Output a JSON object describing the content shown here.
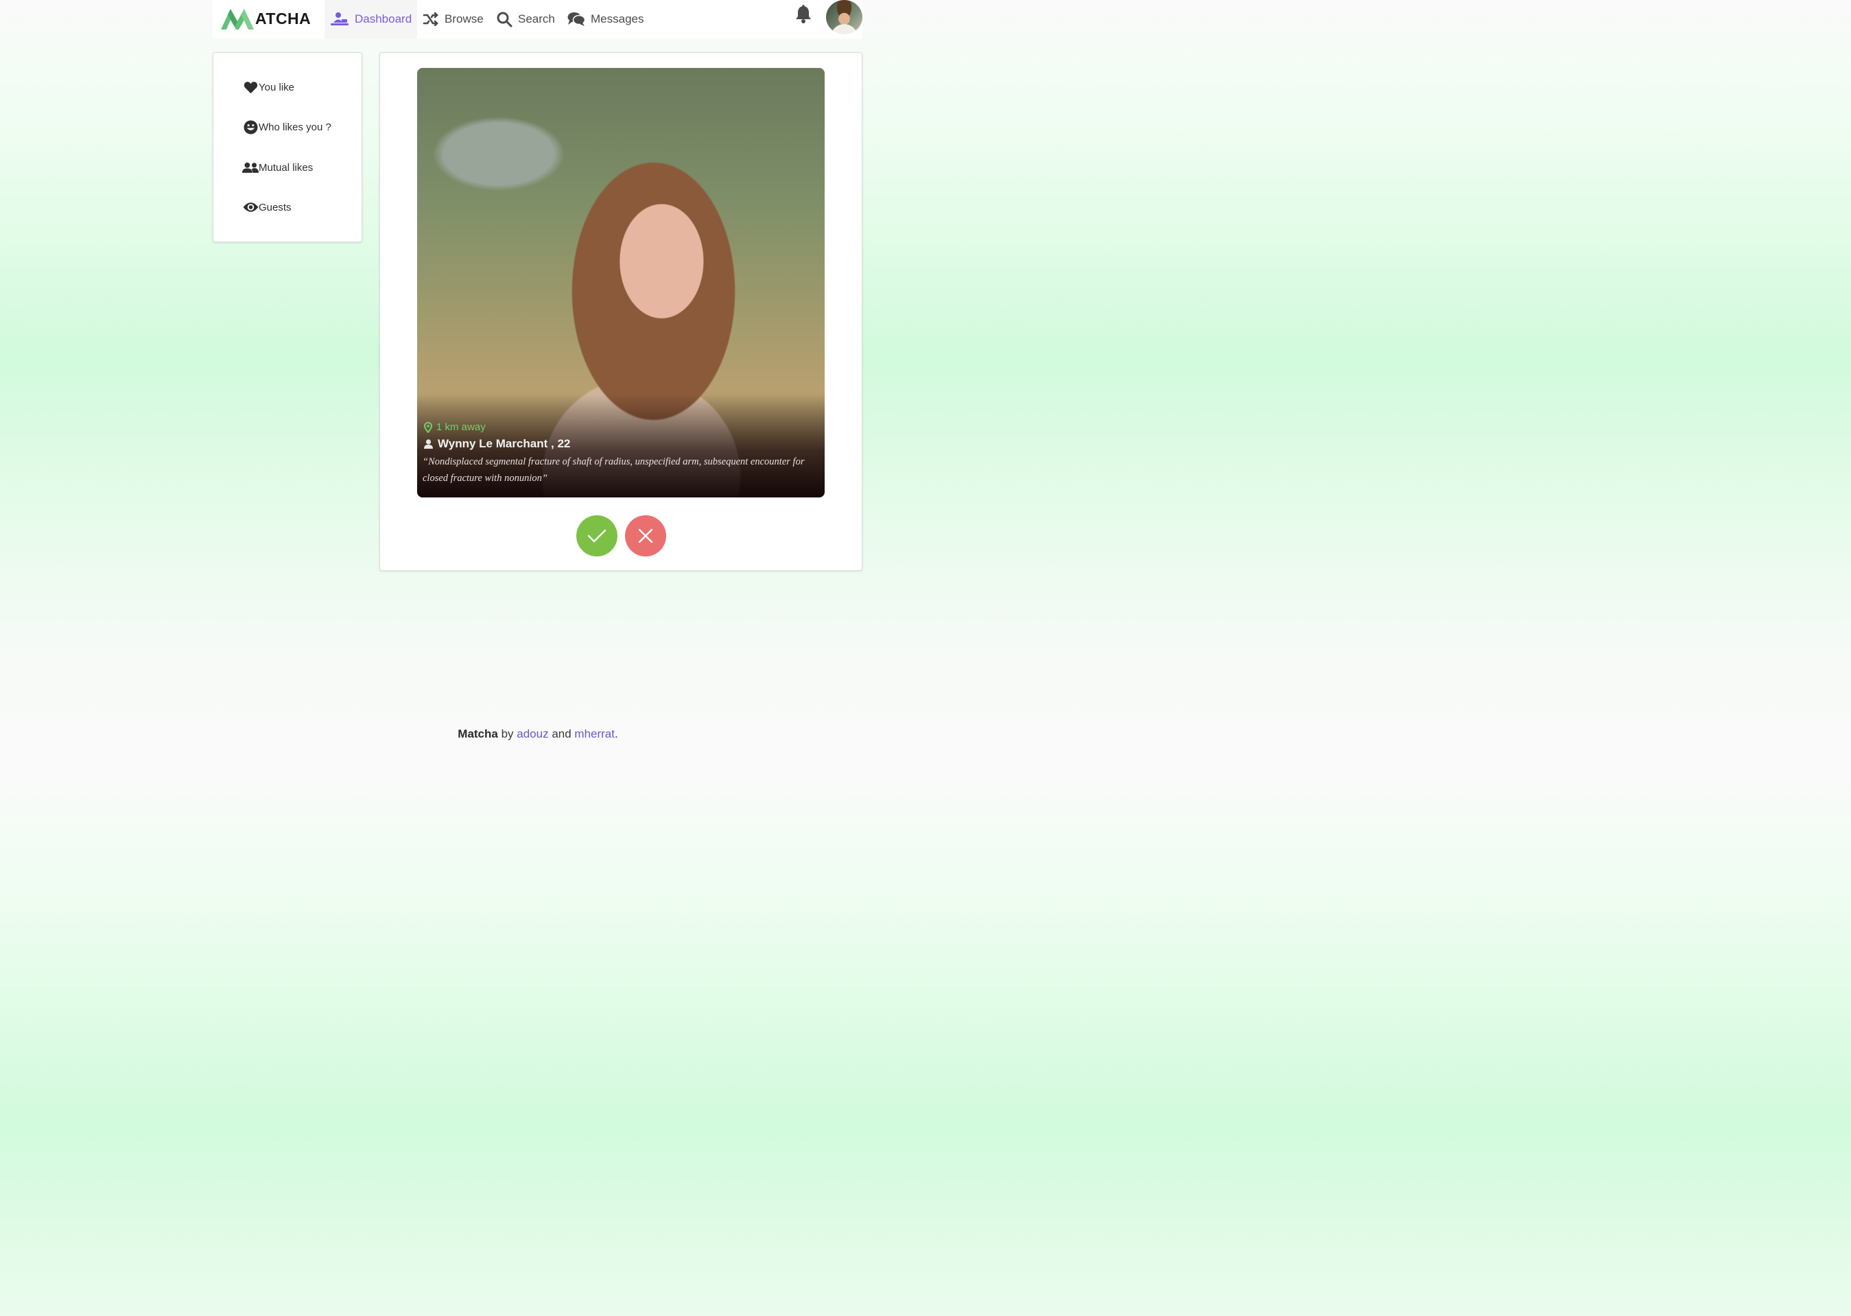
{
  "brand": {
    "logo_text": "ATCHA"
  },
  "nav": {
    "dashboard": "Dashboard",
    "browse": "Browse",
    "search": "Search",
    "messages": "Messages",
    "active": "dashboard"
  },
  "sidebar": {
    "items": [
      {
        "label": "You like",
        "icon": "heart-icon"
      },
      {
        "label": "Who likes you ?",
        "icon": "grin-face-icon"
      },
      {
        "label": "Mutual likes",
        "icon": "users-icon"
      },
      {
        "label": "Guests",
        "icon": "eye-icon"
      }
    ]
  },
  "profile": {
    "distance": "1 km away",
    "name": "Wynny Le Marchant",
    "age_sep": " , ",
    "age": "22",
    "bio": "“Nondisplaced segmental fracture of shaft of radius, unspecified arm, subsequent encounter for closed fracture with nonunion”"
  },
  "actions": {
    "like": "check-icon",
    "dislike": "close-icon"
  },
  "footer": {
    "brand": "Matcha",
    "by": " by ",
    "author1": "adouz",
    "and": " and ",
    "author2": "mherrat",
    "end": "."
  },
  "colors": {
    "accent": "#7a5cdb",
    "like": "#7cc146",
    "dislike": "#ea6f6f",
    "distance": "#6dd36a",
    "link": "#6a58c8"
  }
}
